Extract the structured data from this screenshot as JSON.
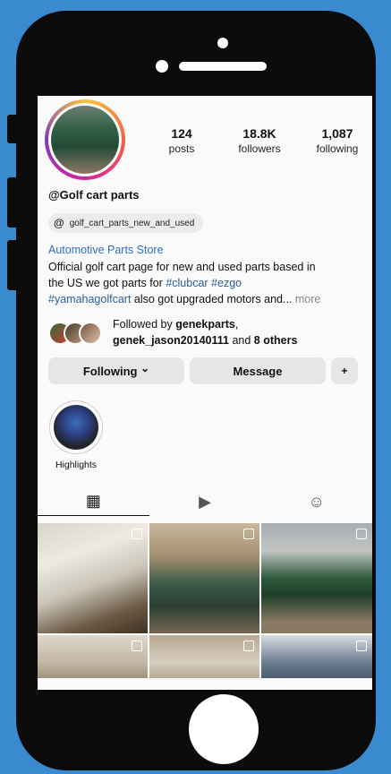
{
  "profile": {
    "username": "@Golf cart parts",
    "threads_handle": "golf_cart_parts_new_and_used",
    "category": "Automotive Parts Store",
    "bio_line1": "Official golf cart page for new and used parts based in",
    "bio_line2_prefix": "the US we got parts for ",
    "bio_tag1": "#clubcar",
    "bio_tag2": "#ezgo",
    "bio_tag3": "#yamahagolfcart",
    "bio_line3_suffix": " also got upgraded motors and...",
    "bio_more": " more"
  },
  "stats": [
    {
      "value": "124",
      "label": "posts"
    },
    {
      "value": "18.8K",
      "label": "followers"
    },
    {
      "value": "1,087",
      "label": "following"
    }
  ],
  "followed_by": {
    "prefix": "Followed by ",
    "user1": "genekparts",
    "user2": "genek_jason20140111",
    "middle": " and ",
    "others": "8 others"
  },
  "buttons": {
    "following": "Following",
    "following_chevron": "⌄",
    "message": "Message",
    "add_person": "+"
  },
  "highlights": [
    {
      "label": "Highlights"
    }
  ],
  "tabs": [
    {
      "icon": "grid-icon",
      "glyph": "▦"
    },
    {
      "icon": "reels-icon",
      "glyph": "▶"
    },
    {
      "icon": "tagged-icon",
      "glyph": "☺"
    }
  ],
  "colors": {
    "background": "#3a8ad0",
    "phone": "#0b0b0b",
    "link": "#2c6fbf"
  }
}
